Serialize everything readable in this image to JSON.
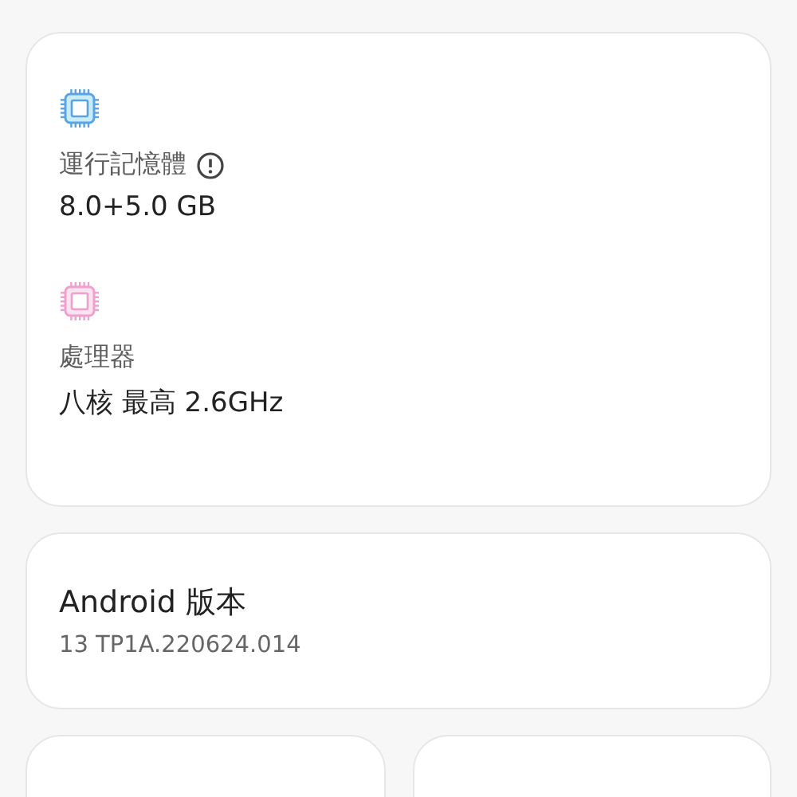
{
  "specs": [
    {
      "kind": "memory",
      "label": "運行記憶體",
      "info": true,
      "value": "8.0+5.0 GB"
    },
    {
      "kind": "processor",
      "label": "處理器",
      "info": false,
      "value": "八核 最高 2.6GHz"
    }
  ],
  "android": {
    "title": "Android 版本",
    "value": "13 TP1A.220624.014"
  },
  "bottom_cards": [
    {
      "kind": "card"
    },
    {
      "kind": "card"
    }
  ]
}
